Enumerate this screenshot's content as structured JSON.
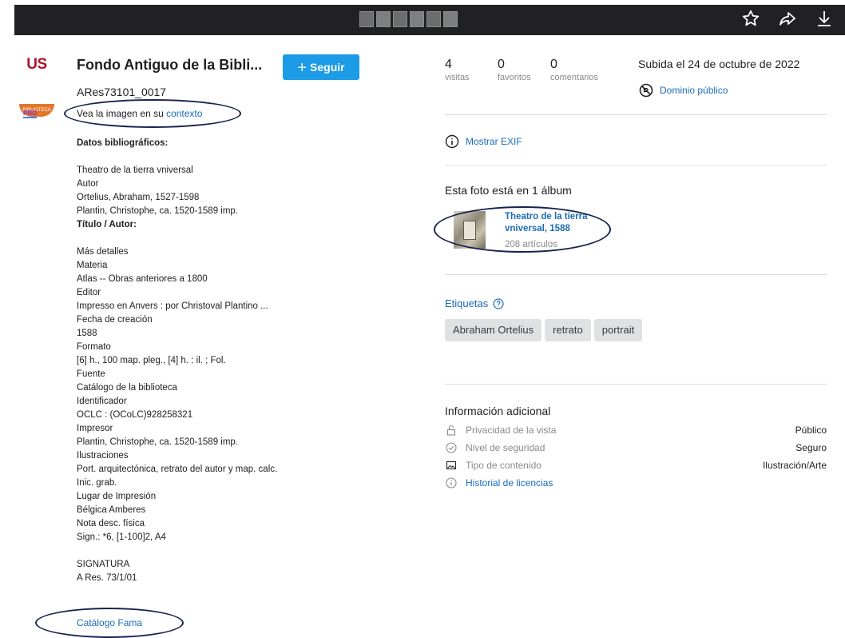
{
  "topbar": {
    "thumbnail_count": 6,
    "icons": [
      "star-icon",
      "share-arrow-icon",
      "download-icon"
    ]
  },
  "owner": {
    "logo_text": "US",
    "logo_band_text": "BIBLIOTECA",
    "pro_badge": "PRO",
    "title": "Fondo Antiguo de la Bibli...",
    "follow_label": "Seguir"
  },
  "photo": {
    "id": "ARes73101_0017",
    "context_prefix": "Vea la imagen en su ",
    "context_link": "contexto",
    "description_lines": [
      {
        "text": "Datos bibliográficos:",
        "bold": true
      },
      {
        "text": "",
        "bold": false
      },
      {
        "text": "Theatro de la tierra vniversal",
        "bold": false
      },
      {
        "text": "Autor",
        "bold": false
      },
      {
        "text": "Ortelius, Abraham, 1527-1598",
        "bold": false
      },
      {
        "text": "Plantin, Christophe, ca. 1520-1589 imp.",
        "bold": false
      },
      {
        "text": "Título / Autor:",
        "bold": true
      },
      {
        "text": "",
        "bold": false
      },
      {
        "text": "Más detalles",
        "bold": false
      },
      {
        "text": "Materia",
        "bold": false
      },
      {
        "text": "Atlas -- Obras anteriores a 1800",
        "bold": false
      },
      {
        "text": "Editor",
        "bold": false
      },
      {
        "text": "Impresso en Anvers : por Christoval Plantino ...",
        "bold": false
      },
      {
        "text": "Fecha de creación",
        "bold": false
      },
      {
        "text": "1588",
        "bold": false
      },
      {
        "text": "Formato",
        "bold": false
      },
      {
        "text": "[6] h., 100 map. pleg., [4] h. : il. ; Fol.",
        "bold": false
      },
      {
        "text": "Fuente",
        "bold": false
      },
      {
        "text": "Catálogo de la biblioteca",
        "bold": false
      },
      {
        "text": "Identificador",
        "bold": false
      },
      {
        "text": "OCLC : (OCoLC)928258321",
        "bold": false
      },
      {
        "text": "Impresor",
        "bold": false
      },
      {
        "text": "Plantin, Christophe, ca. 1520-1589 imp.",
        "bold": false
      },
      {
        "text": "Ilustraciones",
        "bold": false
      },
      {
        "text": "Port. arquitectónica, retrato del autor y map. calc.",
        "bold": false
      },
      {
        "text": "Inic. grab.",
        "bold": false
      },
      {
        "text": "Lugar de Impresión",
        "bold": false
      },
      {
        "text": "Bélgica Amberes",
        "bold": false
      },
      {
        "text": "Nota desc. física",
        "bold": false
      },
      {
        "text": "Sign.: *6, [1-100]2, A4",
        "bold": false
      },
      {
        "text": "",
        "bold": false
      },
      {
        "text": "SIGNATURA",
        "bold": false
      },
      {
        "text": "A Res. 73/1/01",
        "bold": false
      }
    ],
    "catalog_link": "Catálogo Fama"
  },
  "stats": [
    {
      "value": "4",
      "label": "visitas"
    },
    {
      "value": "0",
      "label": "favoritos"
    },
    {
      "value": "0",
      "label": "comentarios"
    }
  ],
  "uploaded": "Subida el 24 de octubre de 2022",
  "license": "Dominio público",
  "exif_link": "Mostrar EXIF",
  "album": {
    "heading": "Esta foto está en 1 álbum",
    "title": "Theatro de la tierra vniversal, 1588",
    "count": "208 artículos"
  },
  "tags": {
    "heading": "Etiquetas",
    "items": [
      "Abraham Ortelius",
      "retrato",
      "portrait"
    ]
  },
  "info": {
    "heading": "Información adicional",
    "rows": [
      {
        "icon": "lock-open-icon",
        "label": "Privacidad de la vista",
        "value": "Público"
      },
      {
        "icon": "check-circle-icon",
        "label": "Nivel de seguridad",
        "value": "Seguro"
      },
      {
        "icon": "image-icon",
        "label": "Tipo de contenido",
        "value": "Ilustración/Arte"
      },
      {
        "icon": "info-icon",
        "label": "Historial de licencias",
        "value": "",
        "link": true
      }
    ]
  },
  "colors": {
    "topbar": "#212124",
    "link": "#1b6bb5",
    "follow_button": "#1c9be6",
    "annotation_oval": "#18224f",
    "tag_bg": "#dfe1e2"
  }
}
